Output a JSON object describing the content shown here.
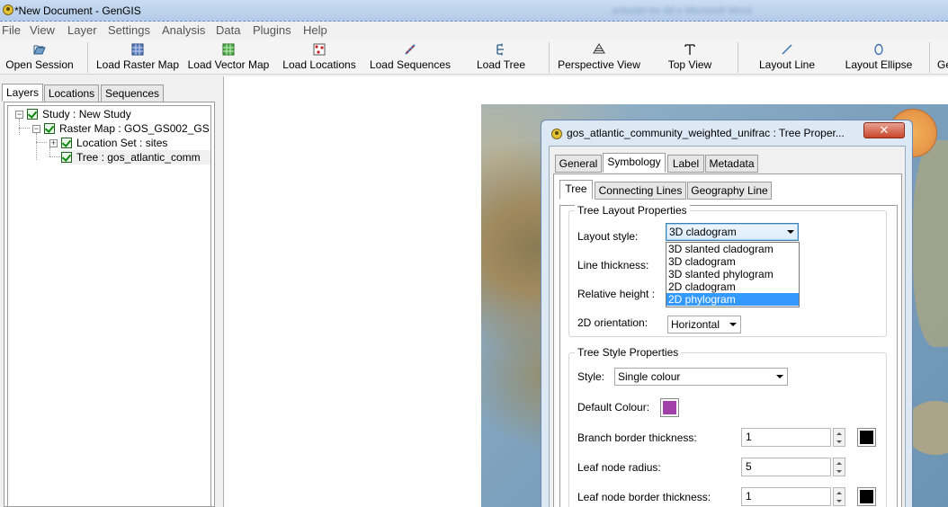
{
  "window": {
    "title": "*New Document - GenGIS",
    "blurred_text": "anbuder'es dd   o    Microsoft Word"
  },
  "menu": [
    "File",
    "View",
    "Layer",
    "Settings",
    "Analysis",
    "Data",
    "Plugins",
    "Help"
  ],
  "toolbar": [
    {
      "label": "Open Session",
      "icon": "open-session-icon"
    },
    {
      "label": "Load Raster Map",
      "icon": "raster-map-icon"
    },
    {
      "label": "Load Vector Map",
      "icon": "vector-map-icon"
    },
    {
      "label": "Load Locations",
      "icon": "locations-icon"
    },
    {
      "label": "Load Sequences",
      "icon": "sequences-icon"
    },
    {
      "label": "Load Tree",
      "icon": "tree-icon"
    },
    {
      "label": "Perspective View",
      "icon": "perspective-icon"
    },
    {
      "label": "Top View",
      "icon": "top-view-icon"
    },
    {
      "label": "Layout Line",
      "icon": "layout-line-icon"
    },
    {
      "label": "Layout Ellipse",
      "icon": "layout-ellipse-icon"
    },
    {
      "label": "Ge",
      "icon": "more-icon"
    }
  ],
  "left_tabs": [
    "Layers",
    "Locations",
    "Sequences"
  ],
  "layers": [
    {
      "label": "Study : New Study"
    },
    {
      "label": "Raster Map : GOS_GS002_GS"
    },
    {
      "label": "Location Set : sites"
    },
    {
      "label": "Tree : gos_atlantic_comm"
    }
  ],
  "dialog": {
    "title": "gos_atlantic_community_weighted_unifrac : Tree Proper...",
    "close_label": "✕",
    "tabs": [
      "General",
      "Symbology",
      "Label",
      "Metadata"
    ],
    "subtabs": [
      "Tree",
      "Connecting Lines",
      "Geography Line"
    ],
    "layout_group": {
      "legend": "Tree Layout Properties",
      "layout_style_label": "Layout style:",
      "layout_style_value": "3D cladogram",
      "layout_options": [
        "3D slanted cladogram",
        "3D cladogram",
        "3D slanted phylogram",
        "2D cladogram",
        "2D phylogram"
      ],
      "highlighted_option": "2D phylogram",
      "line_thickness_label": "Line thickness:",
      "relative_height_label": "Relative height :",
      "orientation_label": "2D orientation:",
      "orientation_value": "Horizontal"
    },
    "style_group": {
      "legend": "Tree Style Properties",
      "style_label": "Style:",
      "style_value": "Single colour",
      "default_colour_label": "Default Colour:",
      "default_colour": "#a040a8",
      "branch_border_label": "Branch border thickness:",
      "branch_border_value": "1",
      "branch_border_colour": "#000000",
      "leaf_radius_label": "Leaf node radius:",
      "leaf_radius_value": "5",
      "leaf_border_label": "Leaf node border thickness:",
      "leaf_border_value": "1",
      "leaf_border_colour": "#000000"
    }
  }
}
